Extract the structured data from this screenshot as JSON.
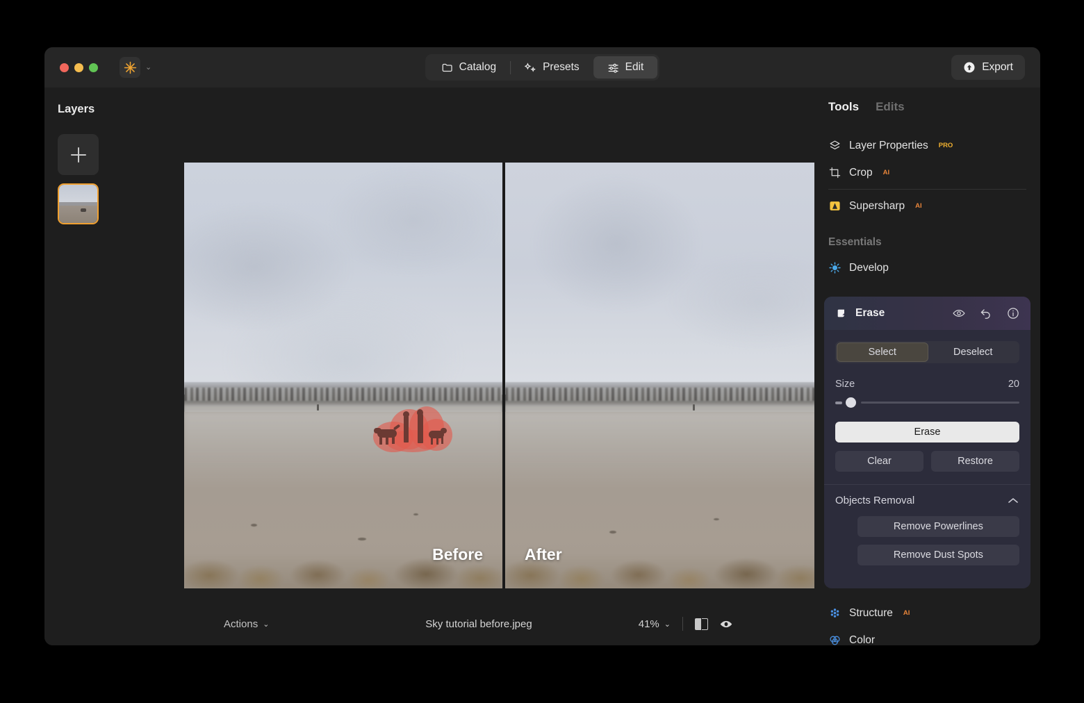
{
  "window": {
    "traffic_lights": [
      "close",
      "minimize",
      "maximize"
    ]
  },
  "titlebar": {
    "logo_icon": "app-star-logo-icon",
    "logo_chevron": "⌄",
    "nav": [
      {
        "label": "Catalog",
        "icon": "folder-icon",
        "active": false
      },
      {
        "label": "Presets",
        "icon": "sparkle-icon",
        "active": false
      },
      {
        "label": "Edit",
        "icon": "sliders-icon",
        "active": true
      }
    ],
    "export": {
      "label": "Export",
      "icon": "export-upload-icon"
    }
  },
  "layers": {
    "title": "Layers",
    "add_button_icon": "plus-icon",
    "thumbnail_name": "layer-thumbnail",
    "selected_border_color": "#f0a030"
  },
  "canvas": {
    "before_label": "Before",
    "after_label": "After",
    "mask_color": "#e25a4e",
    "mask_description": "erase-selection-mask"
  },
  "bottombar": {
    "actions_label": "Actions",
    "actions_chevron": "⌄",
    "filename": "Sky tutorial before.jpeg",
    "zoom_level": "41%",
    "zoom_chevron": "⌄",
    "split_view_icon": "split-view-icon",
    "preview_icon": "eye-icon"
  },
  "right_panel": {
    "tabs": [
      {
        "label": "Tools",
        "active": true
      },
      {
        "label": "Edits",
        "active": false
      }
    ],
    "tools": [
      {
        "label": "Layer Properties",
        "badge": "PRO",
        "badge_type": "pro",
        "icon": "layers-stack-icon"
      },
      {
        "label": "Crop",
        "badge": "AI",
        "badge_type": "ai",
        "icon": "crop-icon"
      },
      {
        "label": "Supersharp",
        "badge": "AI",
        "badge_type": "ai",
        "icon": "supersharp-icon"
      }
    ],
    "essentials_label": "Essentials",
    "essentials": [
      {
        "label": "Develop",
        "badge": "",
        "icon": "develop-sun-icon"
      }
    ],
    "erase_card": {
      "title": "Erase",
      "icon": "eraser-icon",
      "header_icons": [
        "eye-icon",
        "undo-icon",
        "info-icon"
      ],
      "segments": [
        {
          "label": "Select",
          "active": true
        },
        {
          "label": "Deselect",
          "active": false
        }
      ],
      "size_label": "Size",
      "size_value": "20",
      "erase_button": "Erase",
      "clear_button": "Clear",
      "restore_button": "Restore",
      "objects_removal": {
        "title": "Objects Removal",
        "collapse_icon": "chevron-up-icon",
        "buttons": [
          "Remove Powerlines",
          "Remove Dust Spots"
        ]
      }
    },
    "bottom_tools": [
      {
        "label": "Structure",
        "badge": "AI",
        "badge_type": "ai",
        "icon": "structure-flower-icon"
      },
      {
        "label": "Color",
        "badge": "",
        "icon": "color-circles-icon"
      }
    ]
  }
}
